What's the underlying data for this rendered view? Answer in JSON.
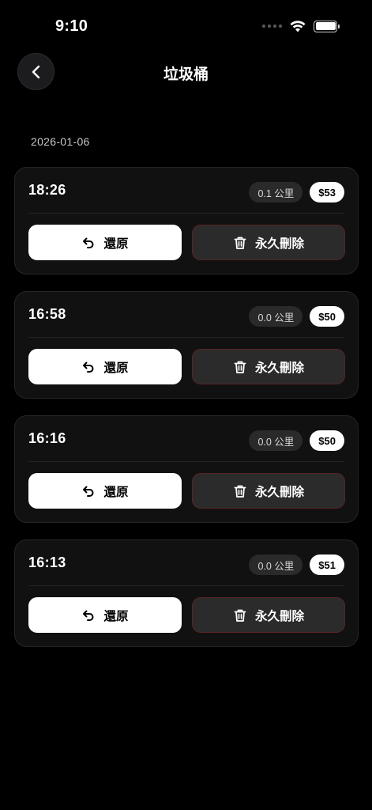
{
  "status_bar": {
    "time": "9:10"
  },
  "header": {
    "title": "垃圾桶"
  },
  "date_group": {
    "date": "2026-01-06"
  },
  "actions": {
    "restore_label": "還原",
    "delete_label": "永久刪除"
  },
  "records": [
    {
      "time": "18:26",
      "distance": "0.1 公里",
      "price": "$53"
    },
    {
      "time": "16:58",
      "distance": "0.0 公里",
      "price": "$50"
    },
    {
      "time": "16:16",
      "distance": "0.0 公里",
      "price": "$50"
    },
    {
      "time": "16:13",
      "distance": "0.0 公里",
      "price": "$51"
    }
  ],
  "colors": {
    "background": "#000000",
    "card": "#111111",
    "delete_border": "#5a2424",
    "badge_dark": "#2a2a2a",
    "accent_white": "#ffffff"
  },
  "icons": {
    "back": "chevron-left-icon",
    "restore": "undo-arrow-icon",
    "delete": "trash-icon",
    "wifi": "wifi-icon",
    "battery": "battery-icon"
  }
}
